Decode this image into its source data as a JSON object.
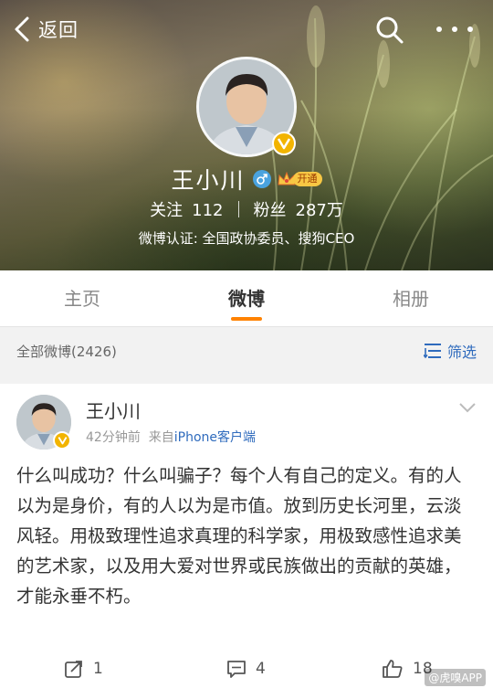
{
  "nav": {
    "back_label": "返回"
  },
  "profile": {
    "name": "王小川",
    "vip_label": "开通",
    "following_label": "关注",
    "following_count": "112",
    "followers_label": "粉丝",
    "followers_count": "287万",
    "verification": "微博认证: 全国政协委员、搜狗CEO"
  },
  "tabs": [
    {
      "label": "主页",
      "active": false
    },
    {
      "label": "微博",
      "active": true
    },
    {
      "label": "相册",
      "active": false
    }
  ],
  "filter": {
    "title": "全部微博(2426)",
    "button_label": "筛选"
  },
  "post": {
    "author": "王小川",
    "time": "42分钟前",
    "source_prefix": "来自",
    "source": "iPhone客户端",
    "text": "什么叫成功？什么叫骗子？每个人有自己的定义。有的人以为是身价，有的人以为是市值。放到历史长河里，云淡风轻。用极致理性追求真理的科学家，用极致感性追求美的艺术家，以及用大爱对世界或民族做出的贡献的英雄，才能永垂不朽。",
    "repost_count": "1",
    "comment_count": "4",
    "like_count": "18"
  },
  "watermark": "@虎嗅APP",
  "colors": {
    "accent": "#ff8200",
    "link": "#2f6bbd",
    "verified": "#f2b400"
  }
}
